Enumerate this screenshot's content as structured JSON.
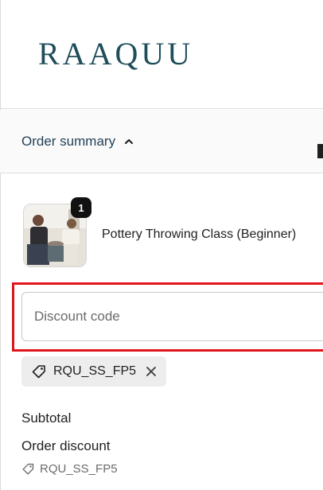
{
  "brand": {
    "logo_text": "RAAQUU",
    "color": "#1f4d5a"
  },
  "summary": {
    "toggle_label": "Order summary",
    "chevron": "chevron-up-icon",
    "color": "#1f3f57"
  },
  "product": {
    "name": "Pottery Throwing Class (Beginner)",
    "quantity": "1"
  },
  "discount": {
    "placeholder": "Discount code",
    "value": "",
    "highlight_color": "#e0151a"
  },
  "applied_code": {
    "code": "RQU_SS_FP5",
    "icon": "tag-icon",
    "remove_icon": "close-icon"
  },
  "totals": {
    "subtotal_label": "Subtotal",
    "order_discount_label": "Order discount",
    "order_discount_code": "RQU_SS_FP5"
  }
}
